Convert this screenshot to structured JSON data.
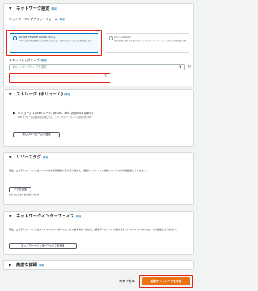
{
  "network": {
    "title": "ネットワーク設定",
    "info": "情報",
    "platform_label": "ネットワーキングプラットフォーム",
    "vpc_option": {
      "title": "Virtual Private Cloud (VPC)",
      "desc": "VPC で実行中の関連付けた状態に対応する、使用するインスタンスを起動します"
    },
    "classic_option": {
      "title": "EC2-Classic",
      "desc": "他の顧客と共有する単一のフラットなネットワークでインスタンスを起動します"
    },
    "sg_label": "セキュリティグループ",
    "sg_placeholder": "セキュリティグループを選択",
    "refresh_icon": "refresh-icon",
    "clear_icon": "close-icon"
  },
  "storage": {
    "title": "ストレージ (ボリューム)",
    "info": "情報",
    "volume_text": "ボリューム 1 (AMI ルート) (8 GiB, EBS, 汎用 SSD (gp2))",
    "volume_note": "AMI ボリュームは復号化に関しては、デバイスのデフォルトで使用されます",
    "add_button": "新しいボリュームを追加"
  },
  "tags": {
    "title": "リソースタグ",
    "info": "情報",
    "empty_text": "現在、このテンプレートにはリソースタグが関連付けられていません。起動テンプレートに含めるリソースタグを追加してください。",
    "add_button": "タグを追加",
    "limit_note": "最大 50 のタグを追加できます"
  },
  "interfaces": {
    "title": "ネットワークインターフェイス",
    "info": "情報",
    "empty_text": "現在、このテンプレートにはネットワークインターフェイスは含まれていません。起動テンプレートに含めるネットワークインターフェイスを追加してください。",
    "add_button": "ネットワークインターフェイスを追加"
  },
  "advanced": {
    "title": "高度な詳細",
    "info": "情報"
  },
  "footer": {
    "cancel": "キャンセル",
    "create": "起動テンプレートを作成"
  },
  "colors": {
    "accent": "#0073bb",
    "primary_button": "#ec7211",
    "highlight": "#e0261b"
  }
}
